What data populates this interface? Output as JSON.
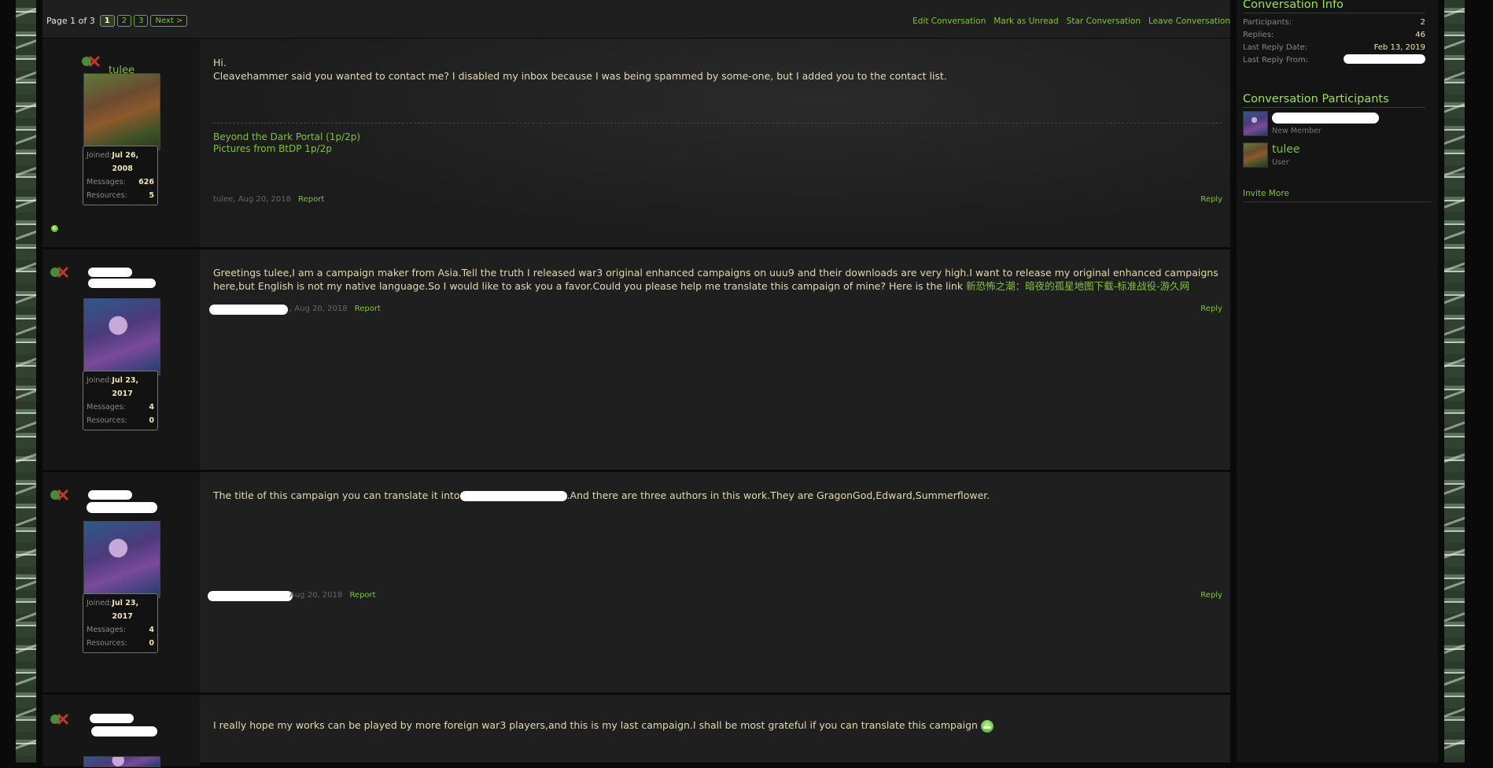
{
  "pagination": {
    "label": "Page 1 of 3",
    "pages": [
      "1",
      "2",
      "3"
    ],
    "next": "Next >"
  },
  "conversation_actions": [
    "Edit Conversation",
    "Mark as Unread",
    "Star Conversation",
    "Leave Conversation"
  ],
  "messages": [
    {
      "author": "tulee",
      "joined_label": "Joined:",
      "joined": "Jul 26, 2008",
      "messages_label": "Messages:",
      "messages": "626",
      "resources_label": "Resources:",
      "resources": "5",
      "body_line1": "Hi.",
      "body_line2": "Cleavehammer said you wanted to contact me? I disabled my inbox because I was being spammed by some-one, but I added you to the contact list.",
      "signature": [
        "Beyond the Dark Portal (1p/2p)",
        "Pictures from BtDP 1p/2p"
      ],
      "meta": "tulee, Aug 20, 2018",
      "report": "Report",
      "reply": "Reply"
    },
    {
      "joined_label": "Joined:",
      "joined": "Jul 23, 2017",
      "messages_label": "Messages:",
      "messages": "4",
      "resources_label": "Resources:",
      "resources": "0",
      "body": "Greetings tulee,I am a campaign maker from Asia.Tell the truth I released war3 original enhanced campaigns on uuu9 and their downloads are very high.I want to release my original enhanced campaigns here,but English is not my native language.So I would like to ask you a favor.Could you please help me translate this campaign of mine? Here is the link ",
      "link": "新恐怖之潮：暗夜的孤星地图下载-标准战役-游久网",
      "meta": ", Aug 20, 2018",
      "report": "Report",
      "reply": "Reply"
    },
    {
      "joined_label": "Joined:",
      "joined": "Jul 23, 2017",
      "messages_label": "Messages:",
      "messages": "4",
      "resources_label": "Resources:",
      "resources": "0",
      "body_a": "The title of this campaign you can translate it into",
      "body_b": ".And there are three authors in this work.They are GragonGod,Edward,Summerflower.",
      "meta": "Aug 20, 2018",
      "report": "Report",
      "reply": "Reply"
    },
    {
      "body": "I really hope my works can be played by more foreign war3 players,and this is my last campaign.I shall be most grateful if you can translate this campaign"
    }
  ],
  "conversation_info": {
    "title": "Conversation Info",
    "participants_label": "Participants:",
    "participants": "2",
    "replies_label": "Replies:",
    "replies": "46",
    "last_reply_date_label": "Last Reply Date:",
    "last_reply_date": "Feb 13, 2019",
    "last_reply_from_label": "Last Reply From:"
  },
  "participants_panel": {
    "title": "Conversation Participants",
    "items": [
      {
        "title": "New Member"
      },
      {
        "name": "tulee",
        "title": "User"
      }
    ],
    "invite": "Invite More"
  },
  "colors": {
    "accent": "#7fc241",
    "heading": "#9be05c",
    "text": "#e3d9b0"
  }
}
